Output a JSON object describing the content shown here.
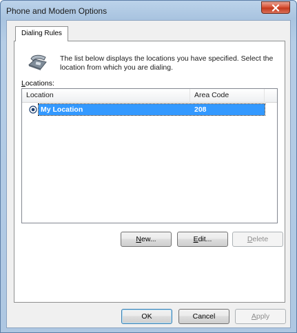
{
  "window": {
    "title": "Phone and Modem Options",
    "close_icon": "close-icon"
  },
  "tabs": [
    {
      "label": "Dialing Rules",
      "selected": true
    }
  ],
  "dialing_rules": {
    "intro_text": "The list below displays the locations you have specified. Select the location from which you are dialing.",
    "locations_label_underlined": "L",
    "locations_label_rest": "ocations:",
    "columns": [
      "Location",
      "Area Code"
    ],
    "rows": [
      {
        "location": "My Location",
        "area_code": "208",
        "selected": true,
        "default": true
      }
    ],
    "buttons": {
      "new": {
        "underline": "N",
        "rest": "ew..."
      },
      "edit": {
        "underline": "E",
        "rest": "dit..."
      },
      "delete": {
        "underline": "D",
        "rest": "elete"
      }
    }
  },
  "footer": {
    "ok": "OK",
    "cancel": "Cancel",
    "apply_underline": "A",
    "apply_rest": "pply"
  },
  "colors": {
    "selection": "#3399ff",
    "close_button": "#c43a1d"
  }
}
